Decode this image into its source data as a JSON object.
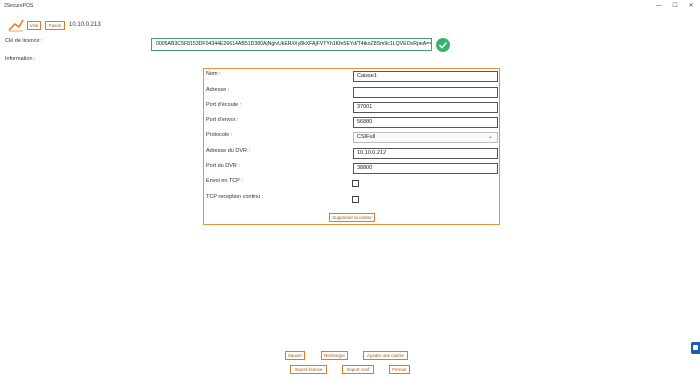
{
  "window": {
    "title": "2SecurePOS",
    "minimize": "—",
    "maximize": "☐",
    "close": "✕"
  },
  "header": {
    "view_label": "Vise",
    "favori_label": "Favori",
    "ip": "10.10.0.213"
  },
  "license": {
    "label": "Clé de licence :",
    "value": "0005AB3C5F8153DF04344E26614AB51D380AjNgivUkER/iXy8kXFAjFVTYh1Kfe5EYd/T4tkoZ8Sm9c1LQVEOvRpeA=="
  },
  "info_label": "Information :",
  "form": {
    "nom_label": "Nom :",
    "nom_value": "Caisse1",
    "adresse_label": "Adresse :",
    "adresse_value": "",
    "port_ecoute_label": "Port d'écoute :",
    "port_ecoute_value": "37001",
    "port_envoi_label": "Port d'envoi :",
    "port_envoi_value": "56880",
    "protocole_label": "Protocole :",
    "protocole_value": "CSIFull",
    "adresse_dvr_label": "Adresse du DVR :",
    "adresse_dvr_value": "10.10.0.212",
    "port_dvr_label": "Port du DVR :",
    "port_dvr_value": "38800",
    "envoi_tcp_label": "Envoi en TCP :",
    "tcp_reception_label": "TCP reception continu :",
    "supprimer_label": "Supprimer la caisse"
  },
  "footer": {
    "sauver": "Sauver",
    "recharger": "Recharger",
    "ajouter": "Ajouter une caisse",
    "import_licence": "Import licence",
    "import_conf": "Import conf",
    "fermer": "Fermer"
  },
  "colors": {
    "accent": "#e8781a",
    "success": "#38b36b"
  }
}
